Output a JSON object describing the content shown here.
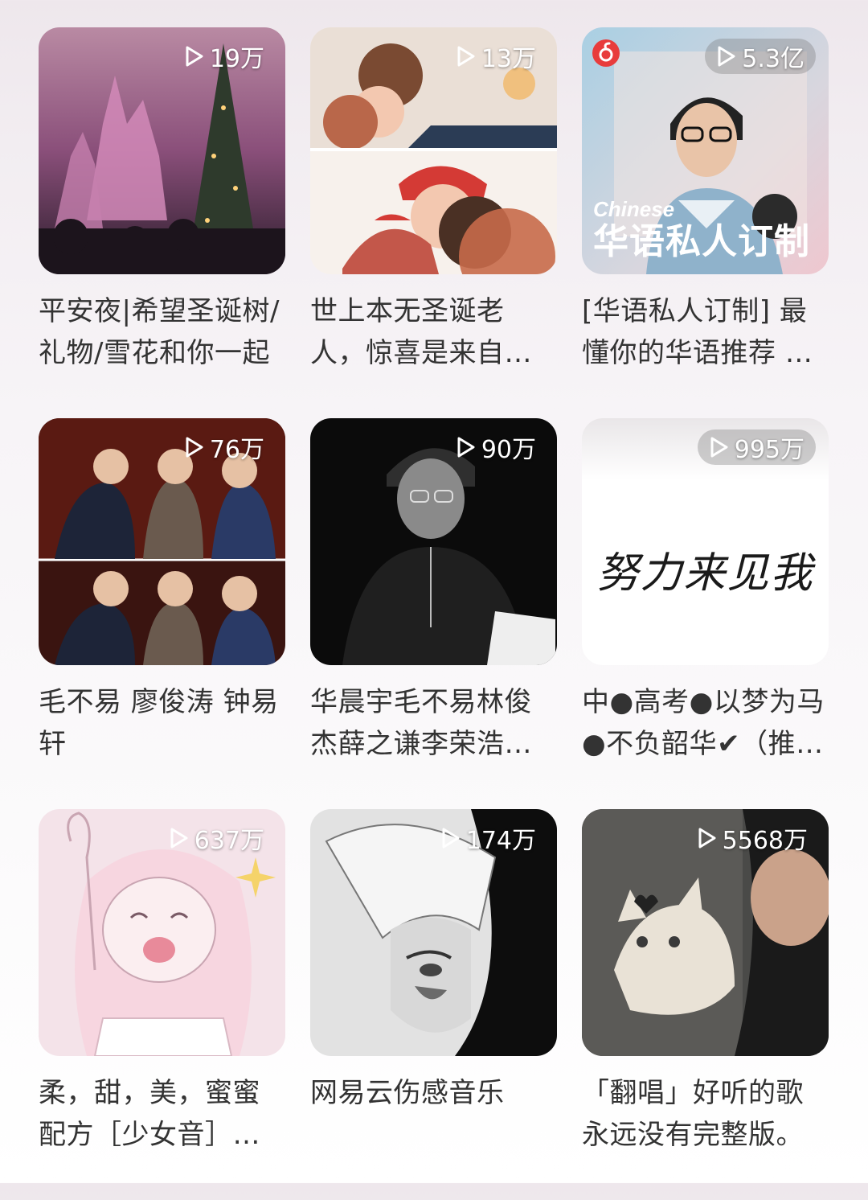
{
  "playlists": [
    {
      "play_count": "19万",
      "title": "平安夜|希望圣诞树/礼物/雪花和你一起",
      "cover_icon": "castle-christmas-tree-photo"
    },
    {
      "play_count": "13万",
      "title": "世上本无圣诞老人，惊喜是来自爱你的人",
      "cover_icon": "christmas-couple-illustration"
    },
    {
      "play_count": "5.3亿",
      "title": "[华语私人订制] 最懂你的华语推荐 每日更新",
      "cover_icon": "singer-portrait",
      "overlay_en": "Chinese",
      "overlay_zh": "华语私人订制"
    },
    {
      "play_count": "76万",
      "title": "毛不易 廖俊涛 钟易轩",
      "cover_icon": "three-singers-stage-photo"
    },
    {
      "play_count": "90万",
      "title": "华晨宇毛不易林俊杰薛之谦李荣浩周杰伦",
      "cover_icon": "singer-black-white-photo"
    },
    {
      "play_count": "995万",
      "title": "中●高考●以梦为马●不负韶华✔（推荐）",
      "cover_icon": "handwriting",
      "handwriting": "努力来见我"
    },
    {
      "play_count": "637万",
      "title": "柔，甜，美，蜜蜜配方［少女音］合集",
      "cover_icon": "anime-girl-sketch"
    },
    {
      "play_count": "174万",
      "title": "网易云伤感音乐",
      "cover_icon": "anime-boy-grayscale"
    },
    {
      "play_count": "5568万",
      "title": "「翻唱」好听的歌永远没有完整版。",
      "cover_icon": "cat-photo"
    }
  ],
  "colors": {
    "text": "#333333",
    "badge_text": "#ffffff",
    "brand_red": "#e83c3c"
  }
}
